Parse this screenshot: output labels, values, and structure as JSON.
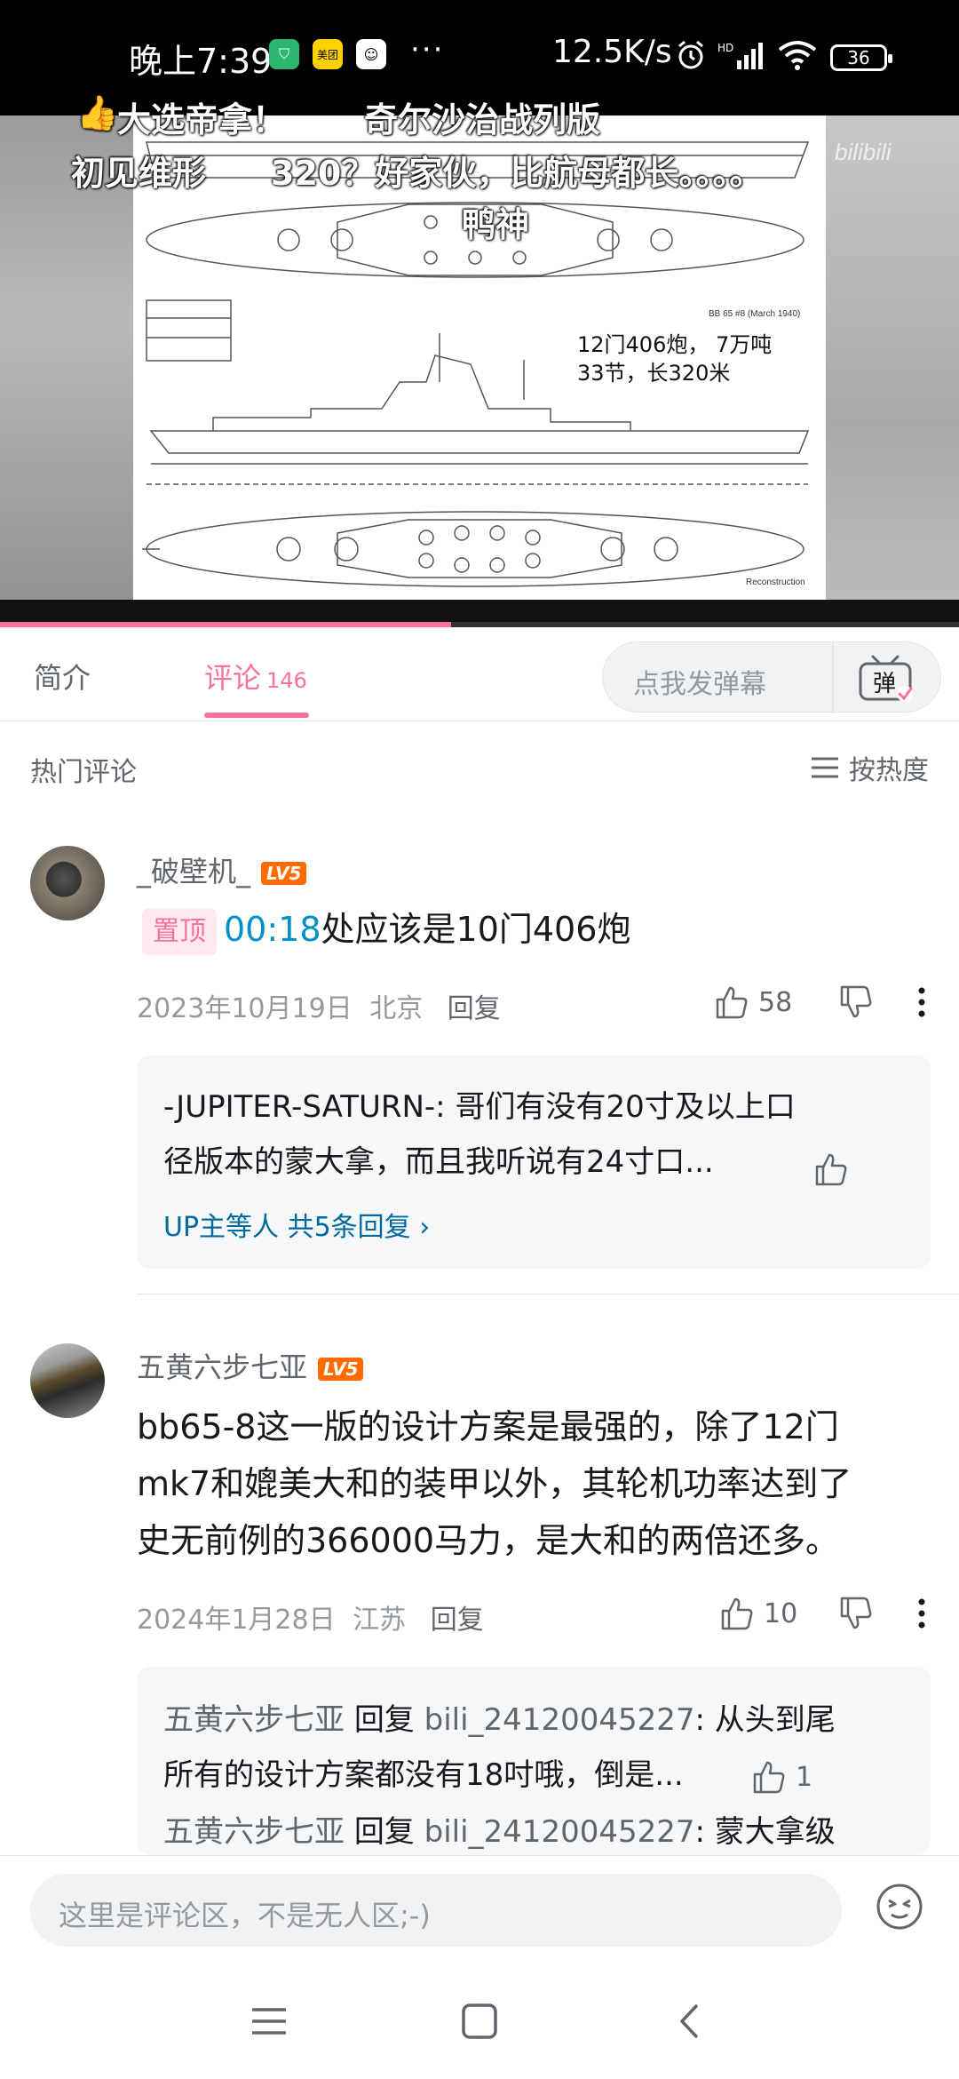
{
  "status_bar": {
    "time": "晚上7:39",
    "app_icons": [
      "shield-app-icon",
      "meituan-app-icon",
      "cartoon-app-icon"
    ],
    "app_labels": [
      "",
      "美团",
      ""
    ],
    "more": "···",
    "net_speed": "12.5K/s",
    "battery": "36"
  },
  "video": {
    "danmaku": [
      "大选帝拿！",
      "奇尔沙治战列版",
      "初见维形",
      "320？好家伙，比航母都长。。。。",
      "鸭神"
    ],
    "drawing_label_top": "BB 65 #8 (March 1940)",
    "drawing_label_bottom": "Reconstruction",
    "note_line1": "12门406炮，  7万吨",
    "note_line2": "33节，长320米",
    "watermark": "bilibili",
    "progress_fraction": 0.47
  },
  "tabs": {
    "intro": "简介",
    "comments": "评论",
    "comments_count": "146",
    "danmu_placeholder": "点我发弹幕",
    "danmu_button": "弹"
  },
  "comments_header": {
    "title": "热门评论",
    "sort": "按热度"
  },
  "comments": [
    {
      "user": "_破壁机_",
      "level": "LV5",
      "pinned_label": "置顶",
      "timestamp_link": "00:18",
      "text": "处应该是10门406炮",
      "date": "2023年10月19日",
      "location": "北京",
      "reply_label": "回复",
      "likes": "58",
      "sub_replies": [
        {
          "line1": "-JUPITER-SATURN-: 哥们有没有20寸及以上口",
          "line2": "径版本的蒙大拿，而且我听说有24寸口..."
        }
      ],
      "more_replies": "UP主等人 共5条回复"
    },
    {
      "user": "五黄六步七亚",
      "level": "LV5",
      "text_lines": [
        "bb65-8这一版的设计方案是最强的，除了12门",
        "mk7和媲美大和的装甲以外，其轮机功率达到了",
        "史无前例的366000马力，是大和的两倍还多。"
      ],
      "date": "2024年1月28日",
      "location": "江苏",
      "reply_label": "回复",
      "likes": "10",
      "sub_replies": [
        {
          "author": "五黄六步七亚",
          "reply_word": "回复",
          "target": "bili_24120045227",
          "line1": ": 从头到尾",
          "line2": "所有的设计方案都没有18吋哦，倒是...",
          "likes": "1"
        },
        {
          "author": "五黄六步七亚",
          "reply_word": "回复",
          "target": "bili_24120045227",
          "line1": ": 蒙大拿级"
        }
      ]
    }
  ],
  "comment_bar": {
    "placeholder": "这里是评论区，不是无人区;-)"
  }
}
